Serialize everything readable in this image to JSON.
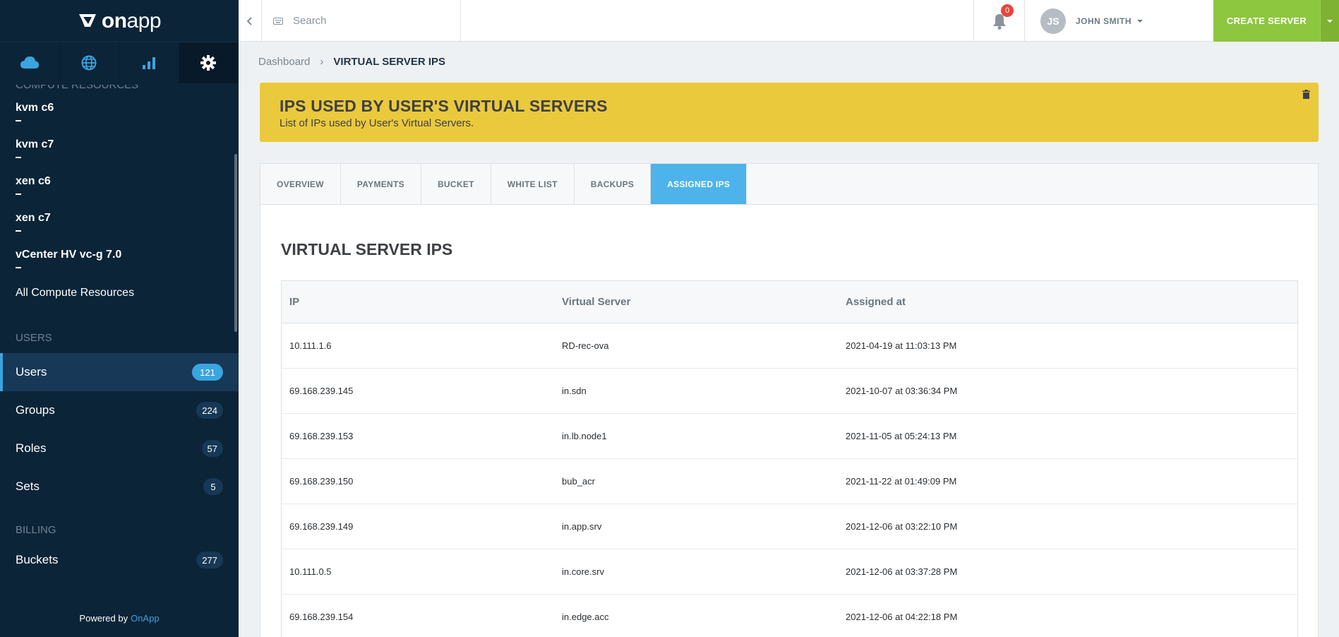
{
  "logo": {
    "text_on": "on",
    "text_app": "app"
  },
  "sidebar": {
    "tabs": [
      {
        "icon": "cloud-icon"
      },
      {
        "icon": "globe-icon"
      },
      {
        "icon": "bar-chart-icon"
      },
      {
        "icon": "gear-icon"
      }
    ],
    "compute_section_label": "COMPUTE RESOURCES",
    "compute_items": [
      "kvm c6",
      "kvm c7",
      "xen c6",
      "xen c7",
      "vCenter HV vc-g 7.0"
    ],
    "all_compute": "All Compute Resources",
    "users_section_label": "USERS",
    "users_items": [
      {
        "label": "Users",
        "count": "121"
      },
      {
        "label": "Groups",
        "count": "224"
      },
      {
        "label": "Roles",
        "count": "57"
      },
      {
        "label": "Sets",
        "count": "5"
      }
    ],
    "billing_section_label": "BILLING",
    "billing_items": [
      {
        "label": "Buckets",
        "count": "277"
      }
    ],
    "powered_prefix": "Powered by",
    "powered_brand": "OnApp"
  },
  "topbar": {
    "search_placeholder": "Search",
    "notifications_count": "0",
    "user_initials": "JS",
    "user_name": "JOHN SMITH",
    "create_label": "CREATE SERVER"
  },
  "breadcrumb": {
    "root": "Dashboard",
    "current": "VIRTUAL SERVER IPS"
  },
  "banner": {
    "title": "IPS USED BY USER'S VIRTUAL SERVERS",
    "subtitle": "List of IPs used by User's Virtual Servers."
  },
  "tabs": [
    "OVERVIEW",
    "PAYMENTS",
    "BUCKET",
    "WHITE LIST",
    "BACKUPS",
    "ASSIGNED IPS"
  ],
  "content": {
    "title": "VIRTUAL SERVER IPS",
    "columns": [
      "IP",
      "Virtual Server",
      "Assigned at"
    ],
    "rows": [
      [
        "10.111.1.6",
        "RD-rec-ova",
        "2021-04-19 at 11:03:13 PM"
      ],
      [
        "69.168.239.145",
        "in.sdn",
        "2021-10-07 at 03:36:34 PM"
      ],
      [
        "69.168.239.153",
        "in.lb.node1",
        "2021-11-05 at 05:24:13 PM"
      ],
      [
        "69.168.239.150",
        "bub_acr",
        "2021-11-22 at 01:49:09 PM"
      ],
      [
        "69.168.239.149",
        "in.app.srv",
        "2021-12-06 at 03:22:10 PM"
      ],
      [
        "10.111.0.5",
        "in.core.srv",
        "2021-12-06 at 03:37:28 PM"
      ],
      [
        "69.168.239.154",
        "in.edge.acc",
        "2021-12-06 at 04:22:18 PM"
      ]
    ]
  },
  "colors": {
    "sidebar_bg": "#0c2438",
    "accent": "#3aa5e0",
    "banner": "#ebc93c",
    "create": "#8dc63f"
  }
}
